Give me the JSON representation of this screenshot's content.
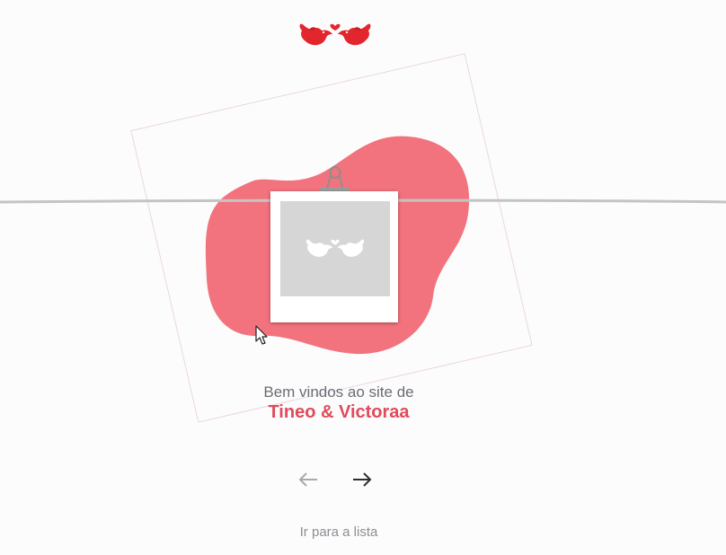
{
  "brand": {
    "icon": "love-birds-icon",
    "color": "#e3262e"
  },
  "hero": {
    "welcome_text": "Bem vindos ao site de",
    "couple_names": "Tineo & Victoraa",
    "blob_color": "#f2737d",
    "photo_placeholder_icon": "love-birds-icon"
  },
  "navigation": {
    "prev_icon": "arrow-left-icon",
    "next_icon": "arrow-right-icon",
    "list_link": "Ir para a lista"
  }
}
